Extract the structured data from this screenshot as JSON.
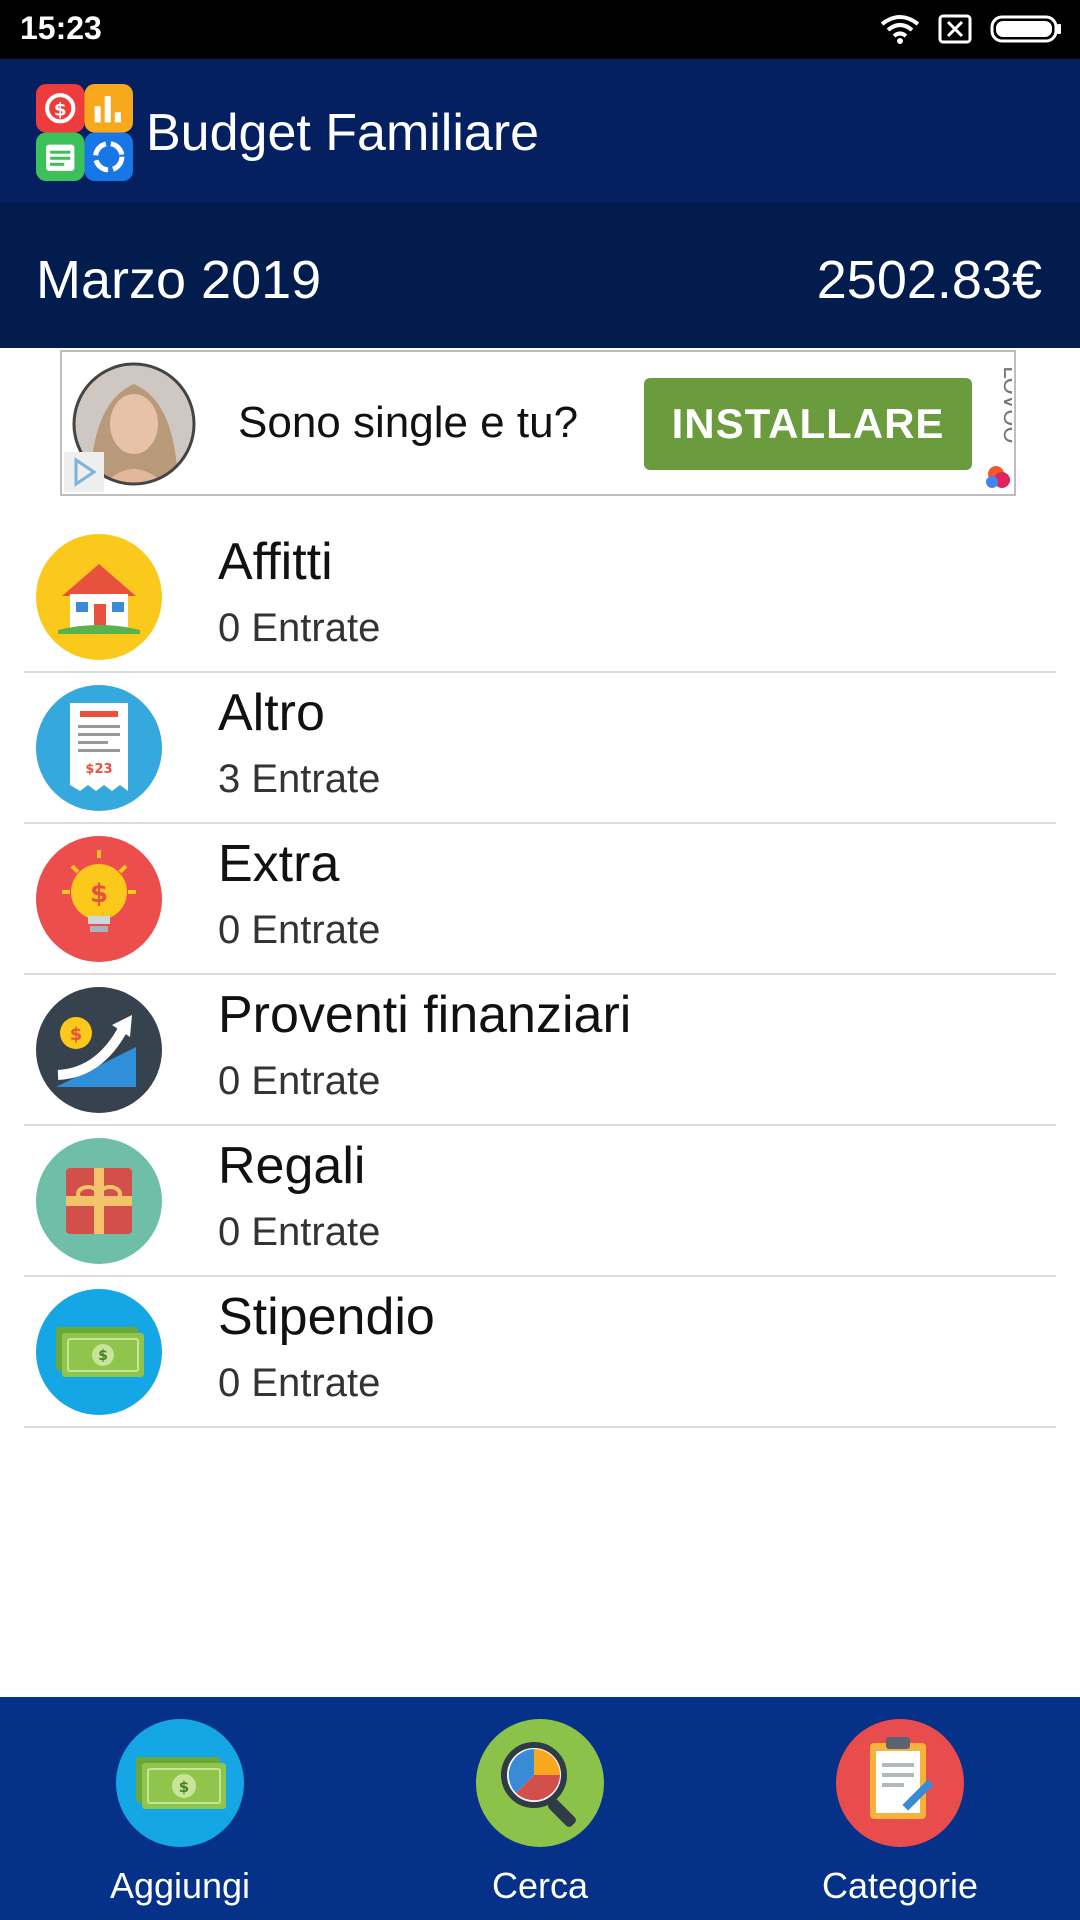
{
  "status_bar": {
    "time": "15:23",
    "icons": [
      "wifi-icon",
      "no-sim-icon",
      "battery-icon"
    ]
  },
  "app_bar": {
    "title": "Budget Familiare",
    "logo_icon": "budget-app-logo-icon"
  },
  "summary": {
    "month": "Marzo 2019",
    "total": "2502.83€"
  },
  "ad": {
    "text": "Sono single e tu?",
    "button_label": "INSTALLARE",
    "brand": "LOVOO",
    "button_color": "#6a9b3c"
  },
  "categories": [
    {
      "name": "Affitti",
      "count": "0 Entrate",
      "icon": "house-icon"
    },
    {
      "name": "Altro",
      "count": "3 Entrate",
      "icon": "receipt-icon"
    },
    {
      "name": "Extra",
      "count": "0 Entrate",
      "icon": "lightbulb-dollar-icon"
    },
    {
      "name": "Proventi finanziari",
      "count": "0 Entrate",
      "icon": "growth-chart-coin-icon"
    },
    {
      "name": "Regali",
      "count": "0 Entrate",
      "icon": "gift-icon"
    },
    {
      "name": "Stipendio",
      "count": "0 Entrate",
      "icon": "banknotes-icon"
    }
  ],
  "receipt_amount": "$23",
  "bottom_nav": [
    {
      "label": "Aggiungi",
      "icon": "banknotes-icon"
    },
    {
      "label": "Cerca",
      "icon": "magnifier-pie-icon"
    },
    {
      "label": "Categorie",
      "icon": "clipboard-pencil-icon"
    }
  ],
  "colors": {
    "app_bar": "#052060",
    "summary_bar": "#021c4e",
    "bottom_nav": "#053288",
    "divider": "#dcdcdc"
  }
}
